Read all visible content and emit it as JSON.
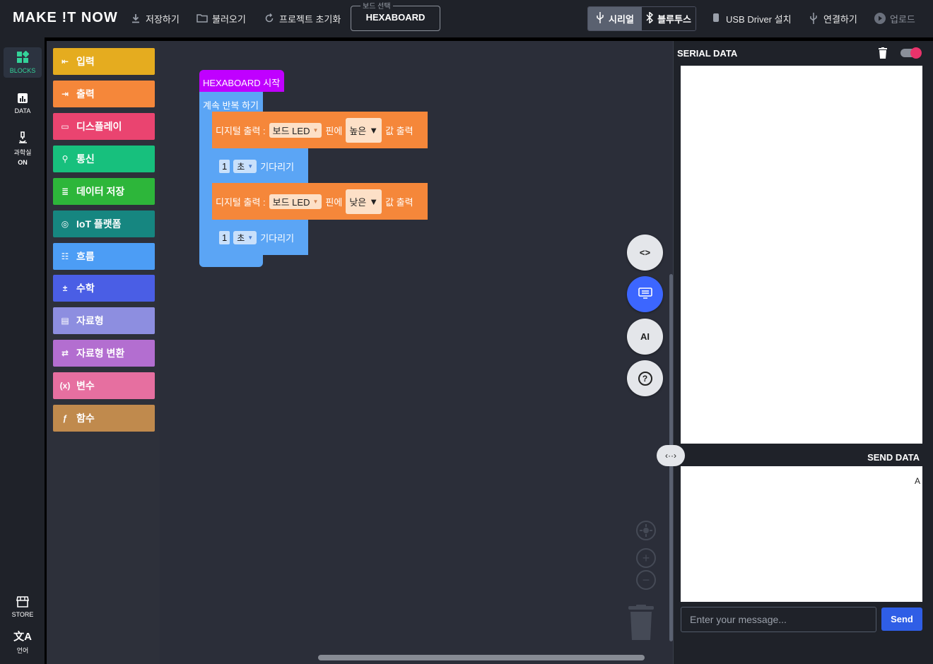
{
  "app": {
    "logo": "MAKE !T NOW"
  },
  "toolbar": {
    "save": "저장하기",
    "load": "불러오기",
    "reset": "프로젝트 초기화",
    "board_label": "보드 선택",
    "board_value": "HEXABOARD",
    "serial": "시리얼",
    "bluetooth": "블루투스",
    "usb_driver": "USB Driver 설치",
    "connect": "연결하기",
    "upload": "업로드"
  },
  "rail": {
    "blocks": "BLOCKS",
    "data": "DATA",
    "science": "과학실",
    "science_state": "ON",
    "store": "STORE",
    "language": "언어"
  },
  "categories": [
    {
      "label": "입력",
      "color": "#e5ac1f",
      "icon": "input-icon"
    },
    {
      "label": "출력",
      "color": "#f5873a",
      "icon": "output-icon"
    },
    {
      "label": "디스플레이",
      "color": "#ea4470",
      "icon": "display-icon"
    },
    {
      "label": "통신",
      "color": "#17c07d",
      "icon": "network-icon"
    },
    {
      "label": "데이터 저장",
      "color": "#2db63a",
      "icon": "storage-icon"
    },
    {
      "label": "IoT 플랫폼",
      "color": "#168680",
      "icon": "iot-icon"
    },
    {
      "label": "흐름",
      "color": "#4c9df5",
      "icon": "flow-icon"
    },
    {
      "label": "수학",
      "color": "#4a5ee5",
      "icon": "math-icon"
    },
    {
      "label": "자료형",
      "color": "#8d8ee0",
      "icon": "datatype-icon"
    },
    {
      "label": "자료형 변환",
      "color": "#b36ed0",
      "icon": "convert-icon"
    },
    {
      "label": "변수",
      "color": "#e66fa0",
      "icon": "variable-icon"
    },
    {
      "label": "함수",
      "color": "#c08a4d",
      "icon": "function-icon"
    }
  ],
  "blocks": {
    "start": "HEXABOARD 시작",
    "loop": "계속 반복 하기",
    "digital1": {
      "prefix": "디지털 출력 :",
      "pin": "보드 LED",
      "pin_suffix": "핀에",
      "value": "높은",
      "suffix": "값 출력"
    },
    "wait1": {
      "number": "1",
      "unit": "초",
      "label": "기다리기"
    },
    "digital2": {
      "prefix": "디지털 출력 :",
      "pin": "보드 LED",
      "pin_suffix": "핀에",
      "value": "낮은",
      "suffix": "값 출력"
    },
    "wait2": {
      "number": "1",
      "unit": "초",
      "label": "기다리기"
    }
  },
  "fabs": {
    "code": "<>",
    "ai": "AI",
    "help": "?"
  },
  "serial": {
    "title": "SERIAL DATA",
    "send_title": "SEND DATA",
    "send_cursor": "A",
    "input_placeholder": "Enter your message...",
    "send_button": "Send",
    "splitter": "‹··›"
  }
}
